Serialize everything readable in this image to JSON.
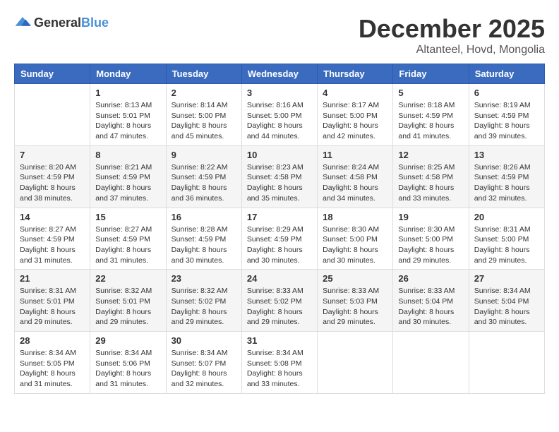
{
  "logo": {
    "text_general": "General",
    "text_blue": "Blue"
  },
  "header": {
    "month_title": "December 2025",
    "location": "Altanteel, Hovd, Mongolia"
  },
  "weekdays": [
    "Sunday",
    "Monday",
    "Tuesday",
    "Wednesday",
    "Thursday",
    "Friday",
    "Saturday"
  ],
  "weeks": [
    [
      {
        "day": "",
        "empty": true
      },
      {
        "day": "1",
        "sunrise": "Sunrise: 8:13 AM",
        "sunset": "Sunset: 5:01 PM",
        "daylight": "Daylight: 8 hours and 47 minutes."
      },
      {
        "day": "2",
        "sunrise": "Sunrise: 8:14 AM",
        "sunset": "Sunset: 5:00 PM",
        "daylight": "Daylight: 8 hours and 45 minutes."
      },
      {
        "day": "3",
        "sunrise": "Sunrise: 8:16 AM",
        "sunset": "Sunset: 5:00 PM",
        "daylight": "Daylight: 8 hours and 44 minutes."
      },
      {
        "day": "4",
        "sunrise": "Sunrise: 8:17 AM",
        "sunset": "Sunset: 5:00 PM",
        "daylight": "Daylight: 8 hours and 42 minutes."
      },
      {
        "day": "5",
        "sunrise": "Sunrise: 8:18 AM",
        "sunset": "Sunset: 4:59 PM",
        "daylight": "Daylight: 8 hours and 41 minutes."
      },
      {
        "day": "6",
        "sunrise": "Sunrise: 8:19 AM",
        "sunset": "Sunset: 4:59 PM",
        "daylight": "Daylight: 8 hours and 39 minutes."
      }
    ],
    [
      {
        "day": "7",
        "sunrise": "Sunrise: 8:20 AM",
        "sunset": "Sunset: 4:59 PM",
        "daylight": "Daylight: 8 hours and 38 minutes."
      },
      {
        "day": "8",
        "sunrise": "Sunrise: 8:21 AM",
        "sunset": "Sunset: 4:59 PM",
        "daylight": "Daylight: 8 hours and 37 minutes."
      },
      {
        "day": "9",
        "sunrise": "Sunrise: 8:22 AM",
        "sunset": "Sunset: 4:59 PM",
        "daylight": "Daylight: 8 hours and 36 minutes."
      },
      {
        "day": "10",
        "sunrise": "Sunrise: 8:23 AM",
        "sunset": "Sunset: 4:58 PM",
        "daylight": "Daylight: 8 hours and 35 minutes."
      },
      {
        "day": "11",
        "sunrise": "Sunrise: 8:24 AM",
        "sunset": "Sunset: 4:58 PM",
        "daylight": "Daylight: 8 hours and 34 minutes."
      },
      {
        "day": "12",
        "sunrise": "Sunrise: 8:25 AM",
        "sunset": "Sunset: 4:58 PM",
        "daylight": "Daylight: 8 hours and 33 minutes."
      },
      {
        "day": "13",
        "sunrise": "Sunrise: 8:26 AM",
        "sunset": "Sunset: 4:59 PM",
        "daylight": "Daylight: 8 hours and 32 minutes."
      }
    ],
    [
      {
        "day": "14",
        "sunrise": "Sunrise: 8:27 AM",
        "sunset": "Sunset: 4:59 PM",
        "daylight": "Daylight: 8 hours and 31 minutes."
      },
      {
        "day": "15",
        "sunrise": "Sunrise: 8:27 AM",
        "sunset": "Sunset: 4:59 PM",
        "daylight": "Daylight: 8 hours and 31 minutes."
      },
      {
        "day": "16",
        "sunrise": "Sunrise: 8:28 AM",
        "sunset": "Sunset: 4:59 PM",
        "daylight": "Daylight: 8 hours and 30 minutes."
      },
      {
        "day": "17",
        "sunrise": "Sunrise: 8:29 AM",
        "sunset": "Sunset: 4:59 PM",
        "daylight": "Daylight: 8 hours and 30 minutes."
      },
      {
        "day": "18",
        "sunrise": "Sunrise: 8:30 AM",
        "sunset": "Sunset: 5:00 PM",
        "daylight": "Daylight: 8 hours and 30 minutes."
      },
      {
        "day": "19",
        "sunrise": "Sunrise: 8:30 AM",
        "sunset": "Sunset: 5:00 PM",
        "daylight": "Daylight: 8 hours and 29 minutes."
      },
      {
        "day": "20",
        "sunrise": "Sunrise: 8:31 AM",
        "sunset": "Sunset: 5:00 PM",
        "daylight": "Daylight: 8 hours and 29 minutes."
      }
    ],
    [
      {
        "day": "21",
        "sunrise": "Sunrise: 8:31 AM",
        "sunset": "Sunset: 5:01 PM",
        "daylight": "Daylight: 8 hours and 29 minutes."
      },
      {
        "day": "22",
        "sunrise": "Sunrise: 8:32 AM",
        "sunset": "Sunset: 5:01 PM",
        "daylight": "Daylight: 8 hours and 29 minutes."
      },
      {
        "day": "23",
        "sunrise": "Sunrise: 8:32 AM",
        "sunset": "Sunset: 5:02 PM",
        "daylight": "Daylight: 8 hours and 29 minutes."
      },
      {
        "day": "24",
        "sunrise": "Sunrise: 8:33 AM",
        "sunset": "Sunset: 5:02 PM",
        "daylight": "Daylight: 8 hours and 29 minutes."
      },
      {
        "day": "25",
        "sunrise": "Sunrise: 8:33 AM",
        "sunset": "Sunset: 5:03 PM",
        "daylight": "Daylight: 8 hours and 29 minutes."
      },
      {
        "day": "26",
        "sunrise": "Sunrise: 8:33 AM",
        "sunset": "Sunset: 5:04 PM",
        "daylight": "Daylight: 8 hours and 30 minutes."
      },
      {
        "day": "27",
        "sunrise": "Sunrise: 8:34 AM",
        "sunset": "Sunset: 5:04 PM",
        "daylight": "Daylight: 8 hours and 30 minutes."
      }
    ],
    [
      {
        "day": "28",
        "sunrise": "Sunrise: 8:34 AM",
        "sunset": "Sunset: 5:05 PM",
        "daylight": "Daylight: 8 hours and 31 minutes."
      },
      {
        "day": "29",
        "sunrise": "Sunrise: 8:34 AM",
        "sunset": "Sunset: 5:06 PM",
        "daylight": "Daylight: 8 hours and 31 minutes."
      },
      {
        "day": "30",
        "sunrise": "Sunrise: 8:34 AM",
        "sunset": "Sunset: 5:07 PM",
        "daylight": "Daylight: 8 hours and 32 minutes."
      },
      {
        "day": "31",
        "sunrise": "Sunrise: 8:34 AM",
        "sunset": "Sunset: 5:08 PM",
        "daylight": "Daylight: 8 hours and 33 minutes."
      },
      {
        "day": "",
        "empty": true
      },
      {
        "day": "",
        "empty": true
      },
      {
        "day": "",
        "empty": true
      }
    ]
  ]
}
